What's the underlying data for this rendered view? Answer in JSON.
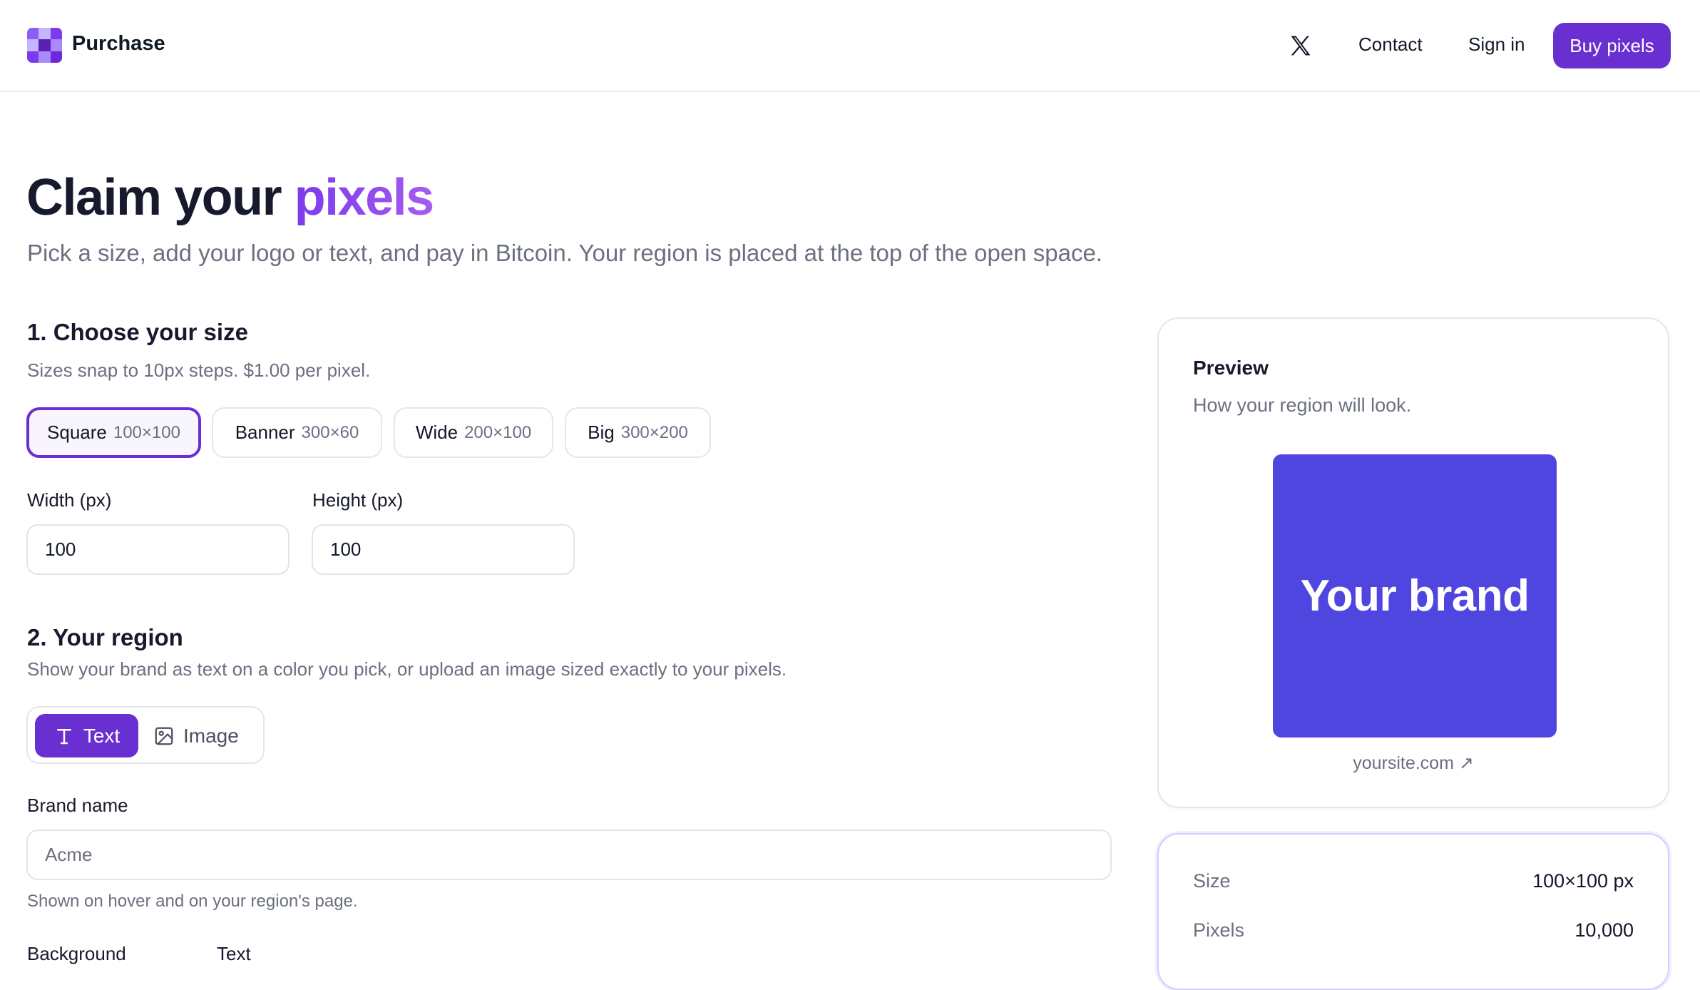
{
  "header": {
    "app_name": "Purchase",
    "nav": {
      "contact": "Contact",
      "sign_in": "Sign in"
    },
    "cta": "Buy pixels",
    "icons": {
      "logo": "pixel-grid-logo",
      "social": "x-twitter-icon"
    }
  },
  "hero": {
    "title_main": "Claim your",
    "title_accent": "pixels",
    "subtitle": "Pick a size, add your logo or text, and pay in Bitcoin. Your region is placed at the top of the open space."
  },
  "size_section": {
    "heading": "1. Choose your size",
    "hint": "Sizes snap to 10px steps. $1.00 per pixel.",
    "presets": [
      {
        "name": "Square",
        "dims": "100×100",
        "selected": true
      },
      {
        "name": "Banner",
        "dims": "300×60",
        "selected": false
      },
      {
        "name": "Wide",
        "dims": "200×100",
        "selected": false
      },
      {
        "name": "Big",
        "dims": "300×200",
        "selected": false
      }
    ],
    "width_label": "Width (px)",
    "width_value": "100",
    "height_label": "Height (px)",
    "height_value": "100"
  },
  "region_section": {
    "heading": "2. Your region",
    "description": "Show your brand as text on a color you pick, or upload an image sized exactly to your pixels.",
    "mode_text": "Text",
    "mode_image": "Image",
    "selected_mode": "Text",
    "brand_label": "Brand name",
    "brand_placeholder": "Acme",
    "brand_help": "Shown on hover and on your region's page.",
    "background_label": "Background",
    "text_label": "Text"
  },
  "preview": {
    "title": "Preview",
    "subtitle": "How your region will look.",
    "region_text": "Your brand",
    "region_color": "#4f46e0",
    "link": "yoursite.com ↗"
  },
  "summary": {
    "size_label": "Size",
    "size_value": "100×100 px",
    "pixels_label": "Pixels",
    "pixels_value": "10,000"
  },
  "colors": {
    "accent": "#6a2fd0",
    "brand_region": "#4f46e0"
  }
}
